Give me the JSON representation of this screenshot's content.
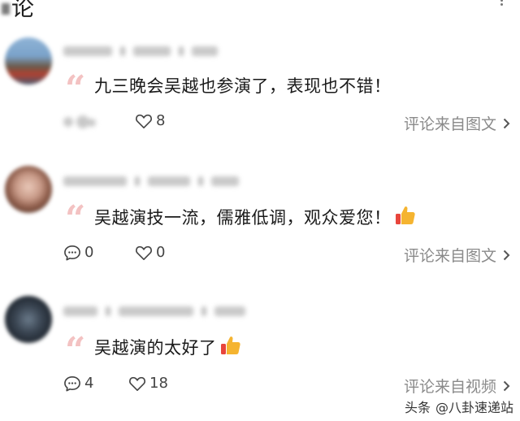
{
  "header": {
    "title_fragment": "论"
  },
  "comments": [
    {
      "text": "九三晚会吴越也参演了，表现也不错！",
      "emoji": "",
      "share_count": "",
      "likes": "8",
      "source": "评论来自图文"
    },
    {
      "text": "吴越演技一流，儒雅低调，观众爱您！",
      "emoji": "thumbs-up",
      "share_count": "0",
      "likes": "0",
      "source": "评论来自图文"
    },
    {
      "text": "吴越演的太好了",
      "emoji": "thumbs-up",
      "share_count": "4",
      "likes": "18",
      "source": "评论来自视频"
    }
  ],
  "watermark": {
    "brand": "头条",
    "handle": "@八卦速递站"
  },
  "colors": {
    "quote_mark": "#f3c2c2",
    "source_text": "#8a8a8a",
    "icon": "#444444",
    "thumb": "#f5b430"
  }
}
